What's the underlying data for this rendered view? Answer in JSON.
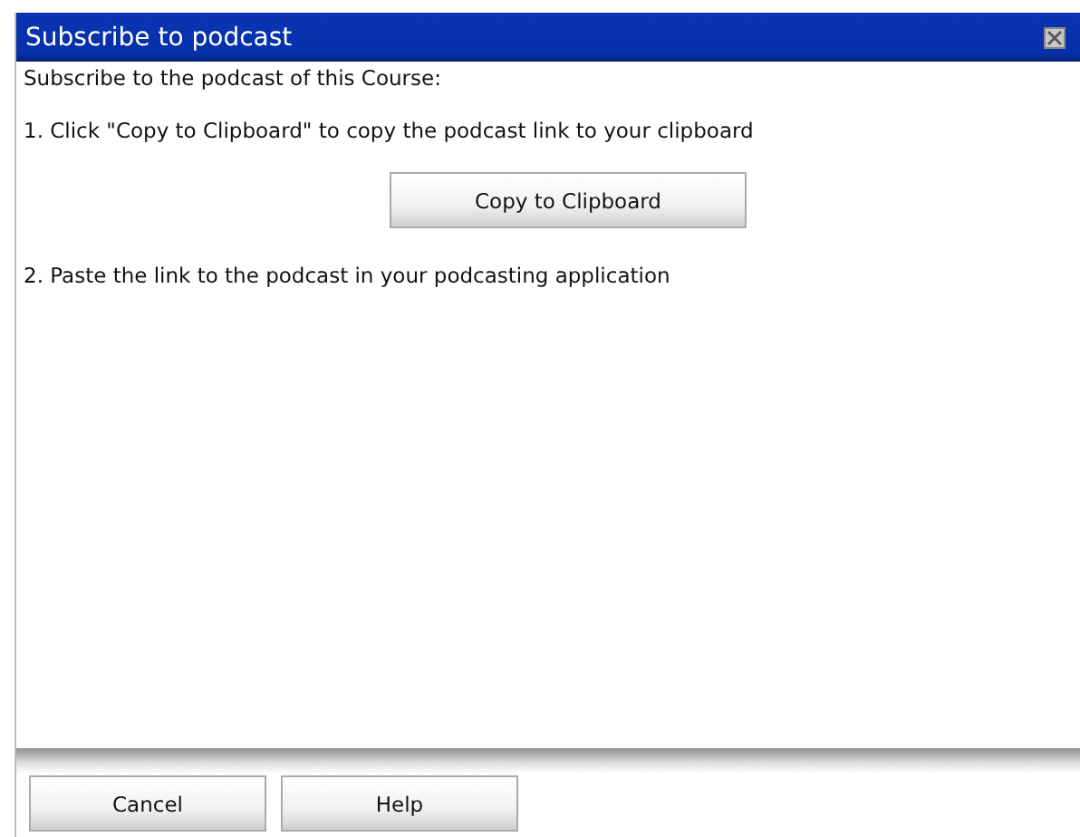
{
  "dialog": {
    "title": "Subscribe to podcast",
    "intro": "Subscribe to the podcast of this Course:",
    "step_1": "1. Click \"Copy to Clipboard\" to copy the podcast link to your clipboard",
    "copy_button": "Copy to Clipboard",
    "step_2": "2. Paste the link to the podcast in your podcasting application",
    "buttons": [
      "Cancel",
      "Help"
    ]
  }
}
